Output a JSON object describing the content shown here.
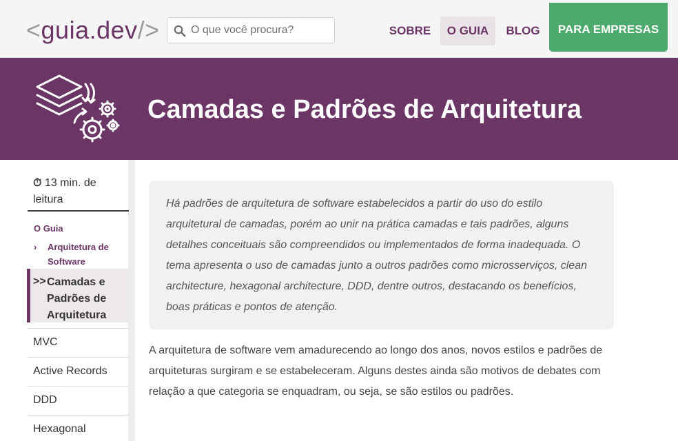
{
  "header": {
    "logo": {
      "open": "<",
      "name": "guia.dev",
      "close": "/>"
    },
    "search": {
      "placeholder": "O que você procura?",
      "icon": "search-icon"
    },
    "nav": [
      {
        "label": "SOBRE"
      },
      {
        "label": "O GUIA",
        "active": true
      },
      {
        "label": "BLOG"
      }
    ],
    "cta_label": "PARA EMPRESAS",
    "colors": {
      "brand": "#6b3566",
      "cta": "#4caa6c"
    }
  },
  "banner": {
    "title": "Camadas e Padrões de Arquitetura",
    "icon": "layers-gears-icon"
  },
  "sidebar": {
    "reading_time": "13 min. de leitura",
    "timer_icon": "⏱",
    "breadcrumb": {
      "root": "O Guia",
      "parent_chevron": "›",
      "parent": "Arquitetura de Software"
    },
    "current": {
      "chevron": ">>",
      "label": "Camadas e Padrões de Arquitetura"
    },
    "items": [
      {
        "label": "MVC"
      },
      {
        "label": "Active Records"
      },
      {
        "label": "DDD"
      },
      {
        "label": "Hexagonal"
      }
    ]
  },
  "main": {
    "intro": "Há padrões de arquitetura de software estabelecidos a partir do uso do estilo arquitetural de camadas, porém ao unir na prática camadas e tais padrões, alguns detalhes conceituais são compreendidos ou implementados de forma inadequada. O tema apresenta o uso de camadas junto a outros padrões como microsserviços, clean architecture, hexagonal architecture, DDD, dentre outros, destacando os benefícios, boas práticas e pontos de atenção.",
    "paragraph": "A arquitetura de software vem amadurecendo ao longo dos anos, novos estilos e padrões de arquiteturas surgiram e se estabeleceram. Alguns destes ainda são motivos de debates com relação a que categoria se enquadram, ou seja, se são estilos ou padrões."
  }
}
